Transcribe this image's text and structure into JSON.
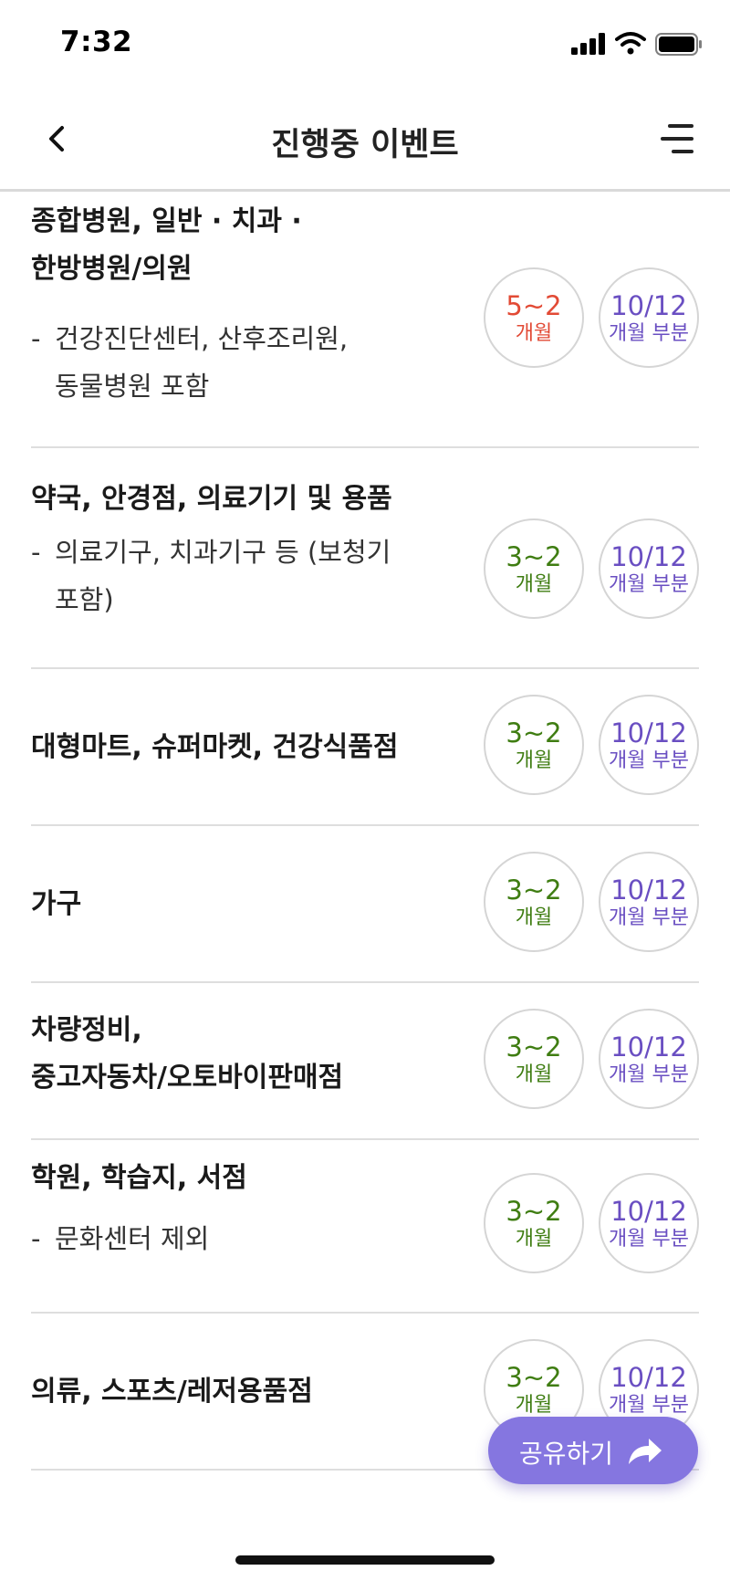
{
  "status_bar": {
    "time": "7:32",
    "icons": [
      "signal-icon",
      "wifi-icon",
      "battery-icon"
    ]
  },
  "nav": {
    "title": "진행중 이벤트",
    "back_icon": "chevron-left-icon",
    "menu_icon": "menu-icon"
  },
  "items": [
    {
      "title": "종합병원, 일반  ·  치과  ·\n한방병원/의원",
      "note": "건강진단센터, 산후조리원,\n동물병원 포함",
      "plan_a": {
        "main": "5~2",
        "sub": "개월",
        "color": "#e24a35"
      },
      "plan_b": {
        "main": "10/12",
        "sub": "개월 부분",
        "color": "#6a4fc2"
      }
    },
    {
      "title": "약국, 안경점, 의료기기 및 용품",
      "note": "의료기구, 치과기구 등 (보청기\n포함)",
      "plan_a": {
        "main": "3~2",
        "sub": "개월",
        "color": "#3f7d12"
      },
      "plan_b": {
        "main": "10/12",
        "sub": "개월 부분",
        "color": "#6a4fc2"
      }
    },
    {
      "title": "대형마트, 슈퍼마켓, 건강식품점",
      "note": "",
      "plan_a": {
        "main": "3~2",
        "sub": "개월",
        "color": "#3f7d12"
      },
      "plan_b": {
        "main": "10/12",
        "sub": "개월 부분",
        "color": "#6a4fc2"
      }
    },
    {
      "title": "가구",
      "note": "",
      "plan_a": {
        "main": "3~2",
        "sub": "개월",
        "color": "#3f7d12"
      },
      "plan_b": {
        "main": "10/12",
        "sub": "개월 부분",
        "color": "#6a4fc2"
      }
    },
    {
      "title": "차량정비,\n중고자동차/오토바이판매점",
      "note": "",
      "plan_a": {
        "main": "3~2",
        "sub": "개월",
        "color": "#3f7d12"
      },
      "plan_b": {
        "main": "10/12",
        "sub": "개월 부분",
        "color": "#6a4fc2"
      }
    },
    {
      "title": "학원, 학습지, 서점",
      "note": "문화센터 제외",
      "plan_a": {
        "main": "3~2",
        "sub": "개월",
        "color": "#3f7d12"
      },
      "plan_b": {
        "main": "10/12",
        "sub": "개월 부분",
        "color": "#6a4fc2"
      }
    },
    {
      "title": "의류, 스포츠/레저용품점",
      "note": "",
      "plan_a": {
        "main": "3~2",
        "sub": "개월",
        "color": "#3f7d12"
      },
      "plan_b": {
        "main": "10/12",
        "sub": "개월 부분",
        "color": "#6a4fc2"
      }
    }
  ],
  "share_button": {
    "label": "공유하기",
    "icon": "share-arrow-icon",
    "color": "#8576e0"
  }
}
